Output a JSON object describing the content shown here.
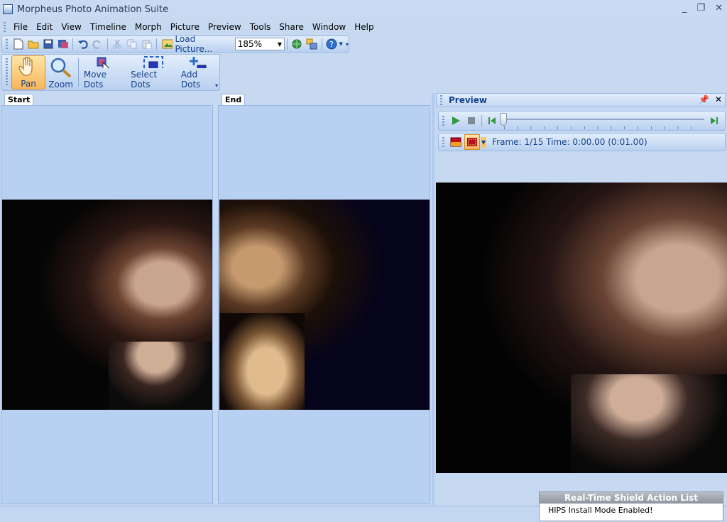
{
  "window": {
    "title": "Morpheus Photo Animation Suite",
    "controls": [
      "_",
      "❐",
      "✕"
    ]
  },
  "menu": [
    "File",
    "Edit",
    "View",
    "Timeline",
    "Morph",
    "Picture",
    "Preview",
    "Tools",
    "Share",
    "Window",
    "Help"
  ],
  "toolbar": {
    "load_label": "Load Picture...",
    "zoom_value": "185%"
  },
  "tools": [
    {
      "label": "Pan",
      "icon": "hand-icon",
      "active": true
    },
    {
      "label": "Zoom",
      "icon": "magnifier-icon"
    },
    {
      "label": "Move Dots",
      "icon": "move-dots-icon"
    },
    {
      "label": "Select Dots",
      "icon": "select-dots-icon"
    },
    {
      "label": "Add Dots",
      "icon": "add-dots-icon"
    }
  ],
  "panels": {
    "start_label": "Start",
    "end_label": "End",
    "preview_title": "Preview"
  },
  "preview": {
    "frame_text": "Frame: 1/15 Time: 0:00.00 (0:01.00)",
    "position": 0.0
  },
  "notification": {
    "title": "Real-Time Shield Action List",
    "message": "HIPS Install Mode Enabled!"
  }
}
